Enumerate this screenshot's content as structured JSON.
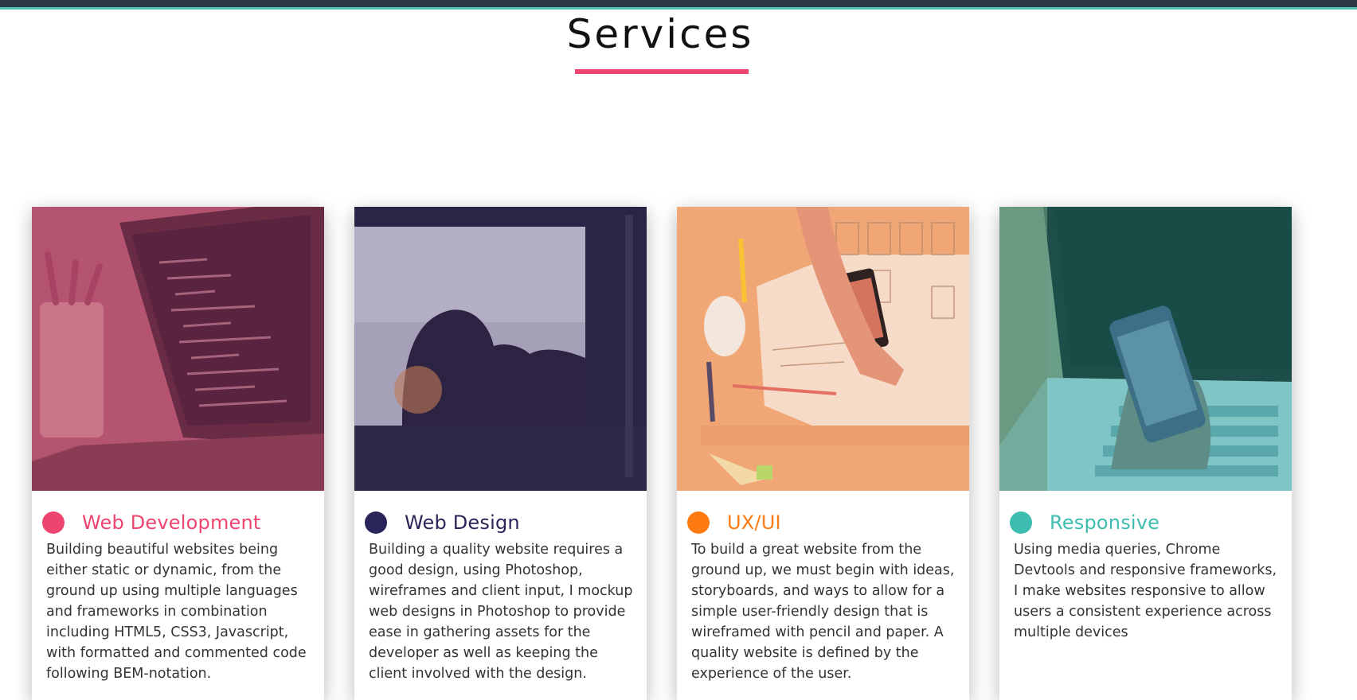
{
  "page": {
    "title": "Services"
  },
  "colors": {
    "accent_pink": "#ee4470",
    "navy": "#2a2558",
    "orange": "#ff7b11",
    "teal": "#3dbdb0",
    "topbar": "#2c3a44",
    "topbar_stripe": "#4fc5b8"
  },
  "services": [
    {
      "name": "Web Development",
      "color": "#ee4470",
      "image": "laptop-code-photo",
      "description": "Building beautiful websites being either static or dynamic, from the ground up using multiple languages and frameworks in combination including HTML5, CSS3, Javascript, with formatted and commented code following BEM-notation."
    },
    {
      "name": "Web Design",
      "color": "#2a2558",
      "image": "monitor-sunset-photo",
      "description": "Building a quality website requires a good design, using Photoshop, wireframes and client input, I mockup web designs in Photoshop to provide ease in gathering assets for the developer as well as keeping the client involved with the design."
    },
    {
      "name": "UX/UI",
      "color": "#ff7b11",
      "image": "wireframe-desk-photo",
      "description": "To build a great website from the ground up, we must begin with ideas, storyboards, and ways to allow for a simple user-friendly design that is wireframed with pencil and paper. A quality website is defined by the experience of the user."
    },
    {
      "name": "Responsive",
      "color": "#3dbdb0",
      "image": "phone-laptop-photo",
      "description": "Using media queries, Chrome Devtools and responsive frameworks, I make websites responsive to allow users a consistent experience across multiple devices"
    }
  ]
}
